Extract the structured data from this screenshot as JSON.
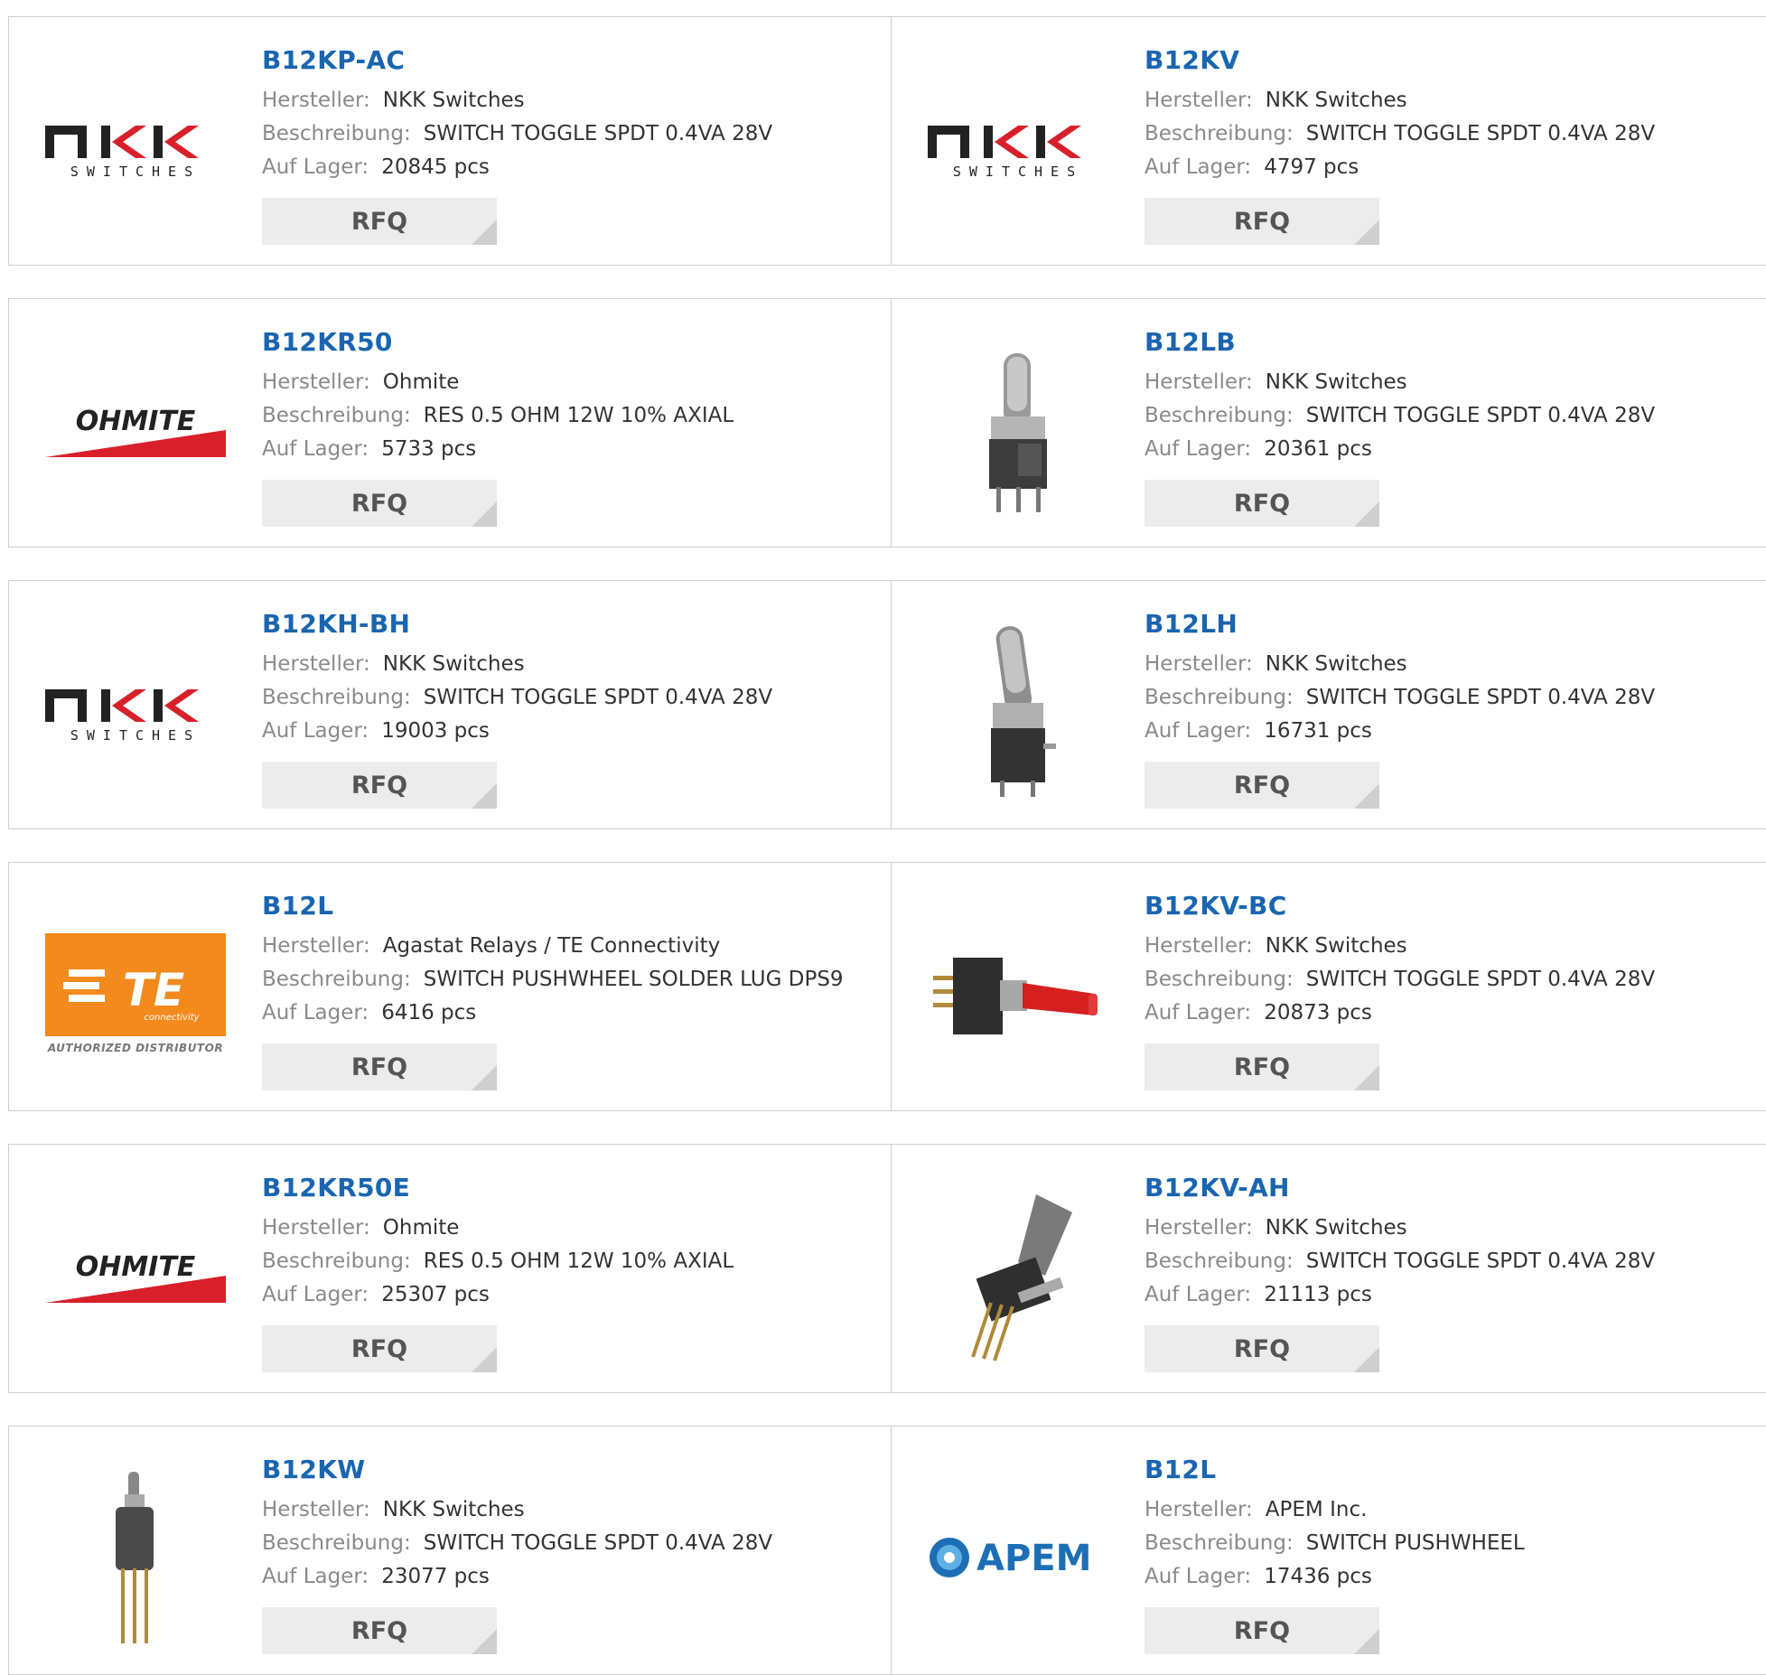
{
  "labels": {
    "manufacturer": "Hersteller:",
    "description": "Beschreibung:",
    "stock": "Auf Lager:",
    "rfq": "RFQ"
  },
  "logos": {
    "nkk_main": "nkk",
    "nkk_sub": "SWITCHES",
    "ohmite": "OHMITE",
    "te": "TE",
    "te_small": "connectivity",
    "te_sub": "AUTHORIZED DISTRIBUTOR",
    "apem": "APEM"
  },
  "products": [
    {
      "part": "B12KP-AC",
      "manufacturer": "NKK Switches",
      "description": "SWITCH TOGGLE SPDT 0.4VA 28V",
      "stock": "20845 pcs",
      "image": "nkk-logo"
    },
    {
      "part": "B12KV",
      "manufacturer": "NKK Switches",
      "description": "SWITCH TOGGLE SPDT 0.4VA 28V",
      "stock": "4797 pcs",
      "image": "nkk-logo"
    },
    {
      "part": "B12KR50",
      "manufacturer": "Ohmite",
      "description": "RES 0.5 OHM 12W 10% AXIAL",
      "stock": "5733 pcs",
      "image": "ohmite-logo"
    },
    {
      "part": "B12LB",
      "manufacturer": "NKK Switches",
      "description": "SWITCH TOGGLE SPDT 0.4VA 28V",
      "stock": "20361 pcs",
      "image": "toggle-switch-photo"
    },
    {
      "part": "B12KH-BH",
      "manufacturer": "NKK Switches",
      "description": "SWITCH TOGGLE SPDT 0.4VA 28V",
      "stock": "19003 pcs",
      "image": "nkk-logo"
    },
    {
      "part": "B12LH",
      "manufacturer": "NKK Switches",
      "description": "SWITCH TOGGLE SPDT 0.4VA 28V",
      "stock": "16731 pcs",
      "image": "toggle-switch-photo"
    },
    {
      "part": "B12L",
      "manufacturer": "Agastat Relays / TE Connectivity",
      "description": "SWITCH PUSHWHEEL SOLDER LUG DPS9",
      "stock": "6416 pcs",
      "image": "te-logo"
    },
    {
      "part": "B12KV-BC",
      "manufacturer": "NKK Switches",
      "description": "SWITCH TOGGLE SPDT 0.4VA 28V",
      "stock": "20873 pcs",
      "image": "red-toggle-photo"
    },
    {
      "part": "B12KR50E",
      "manufacturer": "Ohmite",
      "description": "RES 0.5 OHM 12W 10% AXIAL",
      "stock": "25307 pcs",
      "image": "ohmite-logo"
    },
    {
      "part": "B12KV-AH",
      "manufacturer": "NKK Switches",
      "description": "SWITCH TOGGLE SPDT 0.4VA 28V",
      "stock": "21113 pcs",
      "image": "angled-toggle-photo"
    },
    {
      "part": "B12KW",
      "manufacturer": "NKK Switches",
      "description": "SWITCH TOGGLE SPDT 0.4VA 28V",
      "stock": "23077 pcs",
      "image": "toggle-pins-photo"
    },
    {
      "part": "B12L",
      "manufacturer": "APEM Inc.",
      "description": "SWITCH PUSHWHEEL",
      "stock": "17436 pcs",
      "image": "apem-logo"
    }
  ],
  "colors": {
    "title": "#1a65b0",
    "ohmite_red": "#d8202a",
    "te_orange": "#f28a1e",
    "apem_blue": "#1c6fb5"
  }
}
